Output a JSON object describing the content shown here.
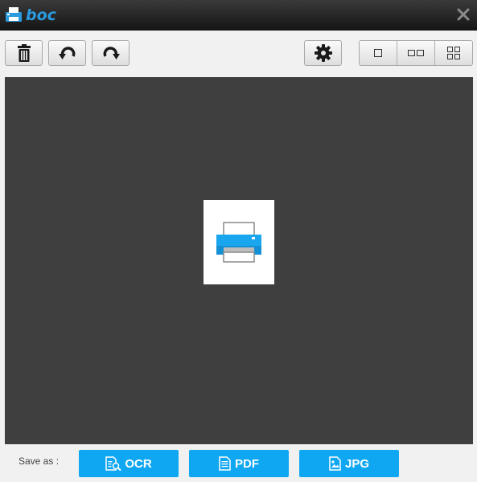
{
  "app": {
    "title": "boc",
    "accent_color": "#2a9be0"
  },
  "toolbar": {
    "left_buttons": [
      {
        "name": "delete-button",
        "icon": "trash-icon"
      },
      {
        "name": "rotate-left-button",
        "icon": "rotate-left-icon"
      },
      {
        "name": "rotate-right-button",
        "icon": "rotate-right-icon"
      }
    ],
    "settings_icon": "gear-icon",
    "view_modes": [
      "single-view-icon",
      "double-view-icon",
      "grid-view-icon"
    ]
  },
  "canvas": {
    "background": "#3f3f3f",
    "thumbnail_icon": "printer-icon"
  },
  "save_bar": {
    "label": "Save as :",
    "button_color": "#10a7f2",
    "buttons": [
      {
        "label": "OCR",
        "icon": "ocr-doc-icon"
      },
      {
        "label": "PDF",
        "icon": "pdf-doc-icon"
      },
      {
        "label": "JPG",
        "icon": "jpg-doc-icon"
      }
    ]
  }
}
